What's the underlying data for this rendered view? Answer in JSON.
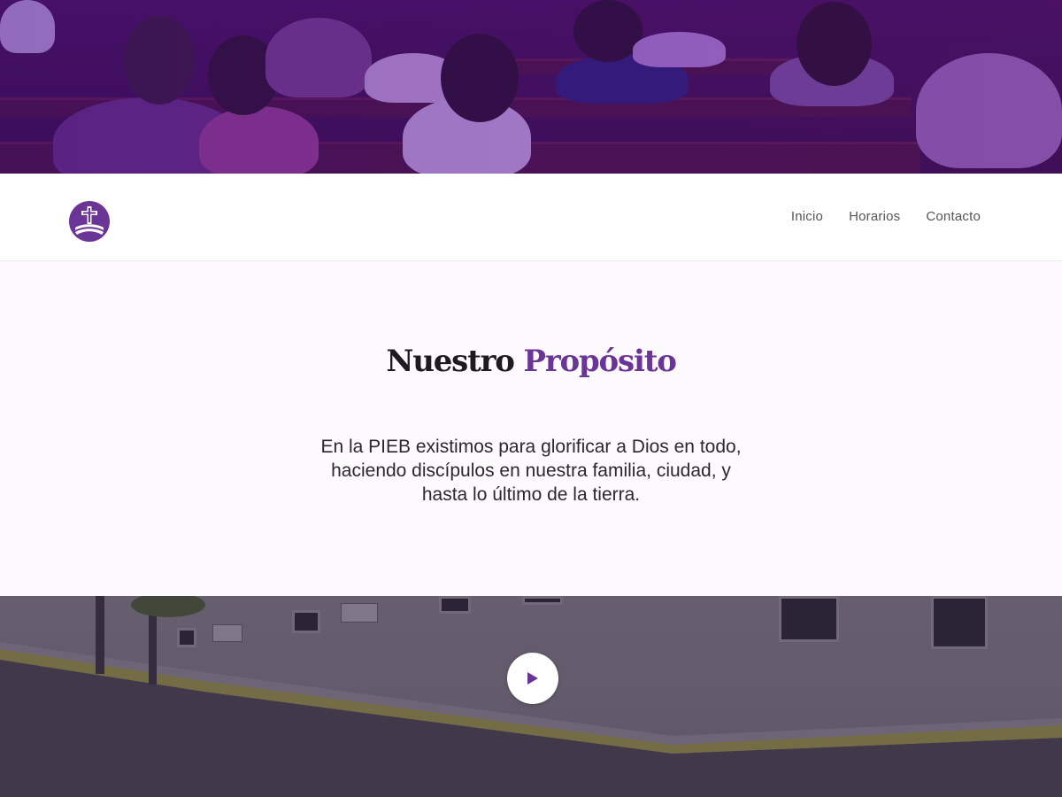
{
  "nav": {
    "items": [
      {
        "label": "Inicio"
      },
      {
        "label": "Horarios"
      },
      {
        "label": "Contacto"
      }
    ]
  },
  "logo": {
    "icon": "church-cross-logo-icon",
    "color": "#6a3596"
  },
  "purpose": {
    "title_part1": "Nuestro",
    "title_part2": "Propósito",
    "text_line1": "En la PIEB existimos para glorificar a Dios en todo,",
    "text_line2": "haciendo discípulos en nuestra familia, ciudad, y",
    "text_line3": "hasta lo último de la tierra."
  },
  "video": {
    "play_icon": "play-icon",
    "accent": "#6a3596"
  },
  "colors": {
    "brand_purple": "#6a3596",
    "hero_tint": "#3a0d4e",
    "text_dark": "#1e1a22"
  }
}
